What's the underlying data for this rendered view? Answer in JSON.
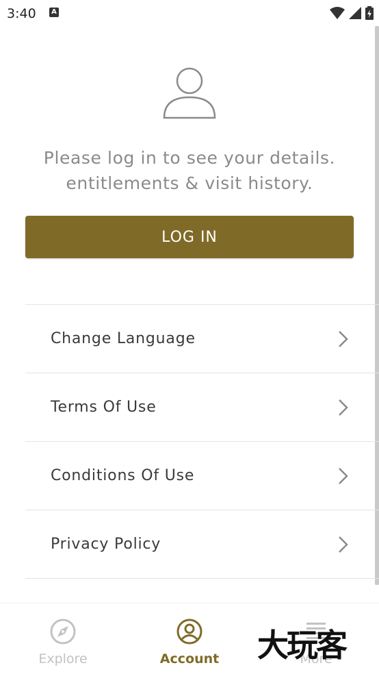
{
  "status_bar": {
    "time": "3:40",
    "notification_letter": "A"
  },
  "account": {
    "message": "Please log in to see your details. entitlements & visit history.",
    "login_label": "LOG IN"
  },
  "menu": {
    "items": [
      {
        "label": "Change Language"
      },
      {
        "label": "Terms Of Use"
      },
      {
        "label": "Conditions Of Use"
      },
      {
        "label": "Privacy Policy"
      }
    ]
  },
  "bottom_nav": {
    "items": [
      {
        "label": "Explore",
        "icon": "compass-icon",
        "active": false
      },
      {
        "label": "Account",
        "icon": "account-circle-icon",
        "active": true
      },
      {
        "label": "More",
        "icon": "menu-lines-icon",
        "active": false
      }
    ]
  },
  "watermark": {
    "text": "大玩客"
  },
  "colors": {
    "accent": "#7f6b27",
    "inactive": "#c2c2c2",
    "message_text": "#8a8a8a"
  }
}
